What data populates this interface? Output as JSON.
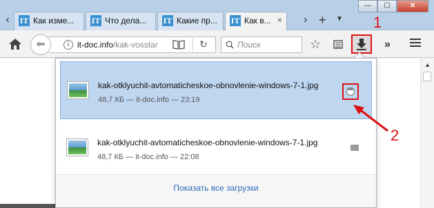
{
  "window": {
    "minimize_label": "—",
    "maximize_label": "☐",
    "close_label": "✕"
  },
  "tabs": [
    {
      "favicon": "IT",
      "label": "Как изме..."
    },
    {
      "favicon": "IT",
      "label": "Что дела..."
    },
    {
      "favicon": "IT",
      "label": "Какие пр..."
    },
    {
      "favicon": "IT",
      "label": "Как в...",
      "active": true
    }
  ],
  "tab_close_label": "×",
  "tab_new_label": "+",
  "toolbar": {
    "url_host": "it-doc.info",
    "url_path": "/kak-vosstar",
    "search_placeholder": "Поиск"
  },
  "downloads": {
    "items": [
      {
        "filename": "kak-otklyuchit-avtomaticheskoe-obnovlenie-windows-7-1.jpg",
        "meta": "48,7 КБ — it-doc.info — 23:19",
        "selected": true
      },
      {
        "filename": "kak-otklyuchit-avtomaticheskoe-obnovlenie-windows-7-1.jpg",
        "meta": "48,7 КБ — it-doc.info — 22:08",
        "selected": false
      }
    ],
    "show_all_label": "Показать все загрузки"
  },
  "annotations": {
    "label_1": "1",
    "label_2": "2",
    "color": "#dd1111"
  }
}
